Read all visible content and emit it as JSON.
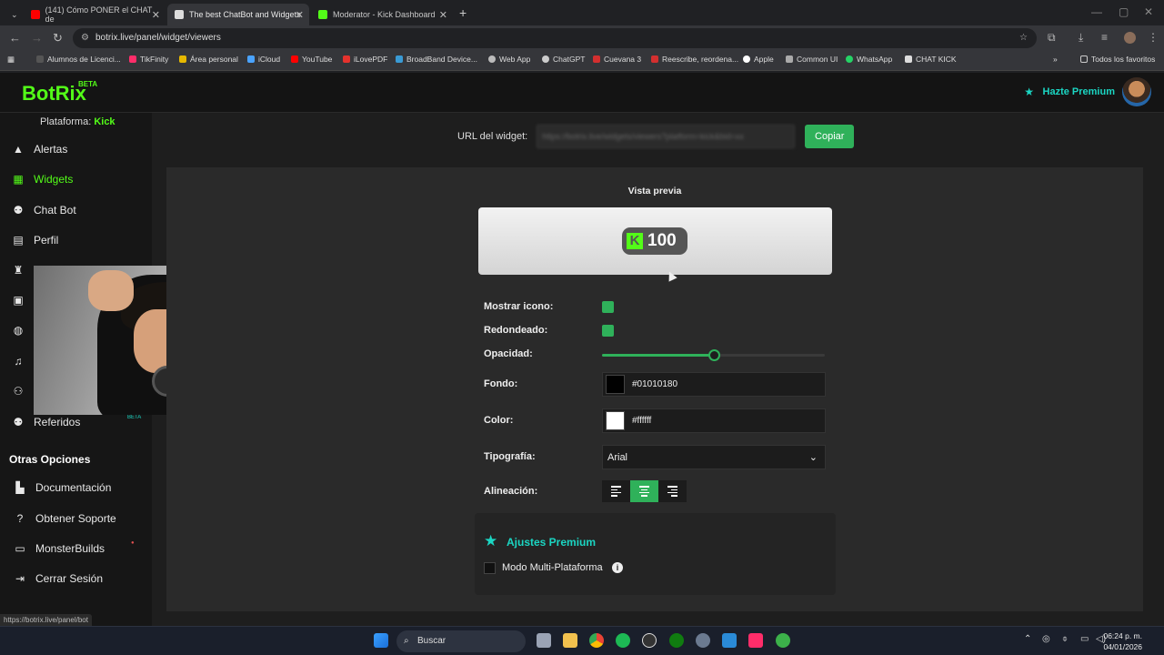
{
  "browser": {
    "tabs": [
      {
        "title": "(141) Cómo PONER el CHAT de",
        "color": "#ff0000"
      },
      {
        "title": "The best ChatBot and Widgets",
        "color": "#ffffff"
      },
      {
        "title": "Moderator - Kick Dashboard",
        "color": "#53fc18"
      }
    ],
    "url": "botrix.live/panel/widget/viewers",
    "bookmarks": [
      "Alumnos de Licenci...",
      "TikFinity",
      "Área personal",
      "iCloud",
      "YouTube",
      "iLovePDF",
      "BroadBand Device...",
      "Web App",
      "ChatGPT",
      "Cuevana 3",
      "Reescribe, reordena...",
      "Apple",
      "Common UI",
      "WhatsApp",
      "CHAT KICK"
    ],
    "all_bookmarks": "Todos los favoritos",
    "status_url": "https://botrix.live/panel/bot"
  },
  "header": {
    "logo": "BotRix",
    "beta": "BETA",
    "premium": "Hazte Premium"
  },
  "sidebar": {
    "platform_label": "Plataforma:",
    "platform_value": "Kick",
    "items": [
      {
        "label": "Alertas",
        "icon": "warning-icon"
      },
      {
        "label": "Widgets",
        "icon": "grid-icon"
      },
      {
        "label": "Chat Bot",
        "icon": "robot-icon"
      },
      {
        "label": "Perfil",
        "icon": "id-card-icon"
      },
      {
        "label": "Referidos",
        "icon": "users-icon"
      }
    ],
    "referidos_badge": "BETA",
    "other_header": "Otras Opciones",
    "other_items": [
      {
        "label": "Documentación",
        "icon": "book-icon"
      },
      {
        "label": "Obtener Soporte",
        "icon": "help-icon"
      },
      {
        "label": "MonsterBuilds",
        "icon": "laptop-icon"
      },
      {
        "label": "Cerrar Sesión",
        "icon": "logout-icon"
      }
    ]
  },
  "widget": {
    "url_label": "URL del widget:",
    "url_value": "https://botrix.live/widgets/viewers?platform=kick&bid=xx",
    "copy_label": "Copiar",
    "preview_title": "Vista previa",
    "preview_count": "100"
  },
  "settings": {
    "show_icon_label": "Mostrar icono:",
    "show_icon": true,
    "rounded_label": "Redondeado:",
    "rounded": true,
    "opacity_label": "Opacidad:",
    "opacity": 0.5,
    "background_label": "Fondo:",
    "background_value": "#01010180",
    "color_label": "Color:",
    "color_value": "#ffffff",
    "font_label": "Tipografía:",
    "font_value": "Arial",
    "align_label": "Alineación:",
    "align_selected": "center"
  },
  "premium_card": {
    "title": "Ajustes Premium",
    "multi_label": "Modo Multi-Plataforma"
  },
  "taskbar": {
    "search_placeholder": "Buscar",
    "time": "06:24 p. m.",
    "date": "04/01/2026"
  },
  "colors": {
    "kick_green": "#53fc18",
    "button_green": "#2fb15a",
    "premium_teal": "#1bd6c3"
  }
}
